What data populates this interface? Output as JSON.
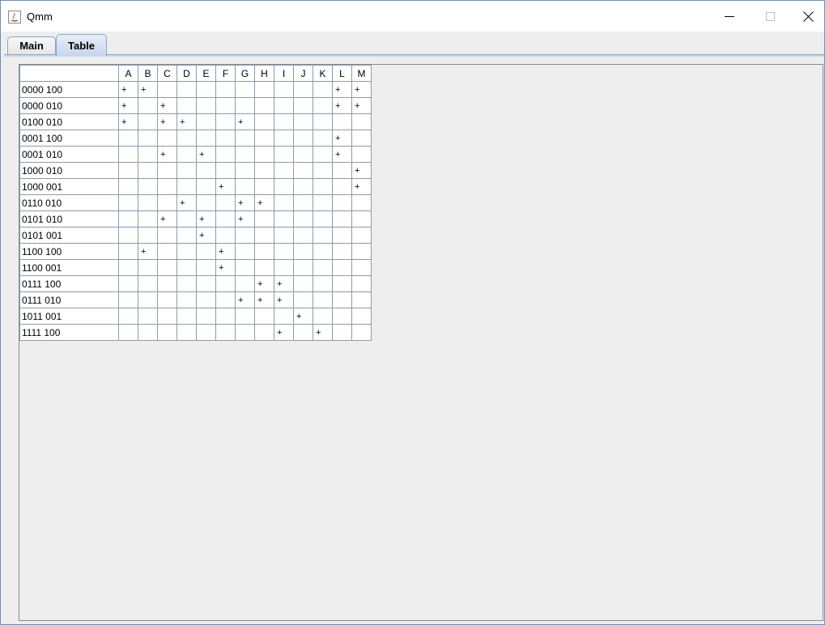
{
  "window": {
    "title": "Qmm",
    "minimize_glyph": "—",
    "maximize_glyph": "☐",
    "close_glyph": "✕"
  },
  "tabs": [
    {
      "label": "Main",
      "selected": false
    },
    {
      "label": "Table",
      "selected": true
    }
  ],
  "table": {
    "corner": "",
    "columns": [
      "A",
      "B",
      "C",
      "D",
      "E",
      "F",
      "G",
      "H",
      "I",
      "J",
      "K",
      "L",
      "M"
    ],
    "rows": [
      {
        "label": "0000 100",
        "cells": [
          "+",
          "+",
          "",
          "",
          "",
          "",
          "",
          "",
          "",
          "",
          "",
          "+",
          "+"
        ]
      },
      {
        "label": "0000 010",
        "cells": [
          "+",
          "",
          "+",
          "",
          "",
          "",
          "",
          "",
          "",
          "",
          "",
          "+",
          "+"
        ]
      },
      {
        "label": "0100 010",
        "cells": [
          "+",
          "",
          "+",
          "+",
          "",
          "",
          "+",
          "",
          "",
          "",
          "",
          "",
          ""
        ]
      },
      {
        "label": "0001 100",
        "cells": [
          "",
          "",
          "",
          "",
          "",
          "",
          "",
          "",
          "",
          "",
          "",
          "+",
          ""
        ]
      },
      {
        "label": "0001 010",
        "cells": [
          "",
          "",
          "+",
          "",
          "+",
          "",
          "",
          "",
          "",
          "",
          "",
          "+",
          ""
        ]
      },
      {
        "label": "1000 010",
        "cells": [
          "",
          "",
          "",
          "",
          "",
          "",
          "",
          "",
          "",
          "",
          "",
          "",
          "+"
        ]
      },
      {
        "label": "1000 001",
        "cells": [
          "",
          "",
          "",
          "",
          "",
          "+",
          "",
          "",
          "",
          "",
          "",
          "",
          "+"
        ]
      },
      {
        "label": "0110 010",
        "cells": [
          "",
          "",
          "",
          "+",
          "",
          "",
          "+",
          "+",
          "",
          "",
          "",
          "",
          ""
        ]
      },
      {
        "label": "0101 010",
        "cells": [
          "",
          "",
          "+",
          "",
          "+",
          "",
          "+",
          "",
          "",
          "",
          "",
          "",
          ""
        ]
      },
      {
        "label": "0101 001",
        "cells": [
          "",
          "",
          "",
          "",
          "+",
          "",
          "",
          "",
          "",
          "",
          "",
          "",
          ""
        ]
      },
      {
        "label": "1100 100",
        "cells": [
          "",
          "+",
          "",
          "",
          "",
          "+",
          "",
          "",
          "",
          "",
          "",
          "",
          ""
        ]
      },
      {
        "label": "1100 001",
        "cells": [
          "",
          "",
          "",
          "",
          "",
          "+",
          "",
          "",
          "",
          "",
          "",
          "",
          ""
        ]
      },
      {
        "label": "0111 100",
        "cells": [
          "",
          "",
          "",
          "",
          "",
          "",
          "",
          "+",
          "+",
          "",
          "",
          "",
          ""
        ]
      },
      {
        "label": "0111 010",
        "cells": [
          "",
          "",
          "",
          "",
          "",
          "",
          "+",
          "+",
          "+",
          "",
          "",
          "",
          ""
        ]
      },
      {
        "label": "1011 001",
        "cells": [
          "",
          "",
          "",
          "",
          "",
          "",
          "",
          "",
          "",
          "+",
          "",
          "",
          ""
        ]
      },
      {
        "label": "1111 100",
        "cells": [
          "",
          "",
          "",
          "",
          "",
          "",
          "",
          "",
          "+",
          "",
          "+",
          "",
          ""
        ]
      }
    ]
  },
  "colors": {
    "background": "#eeeeee",
    "grid_line": "#8a9bb0",
    "selected_tab": "#c7d6ec"
  }
}
